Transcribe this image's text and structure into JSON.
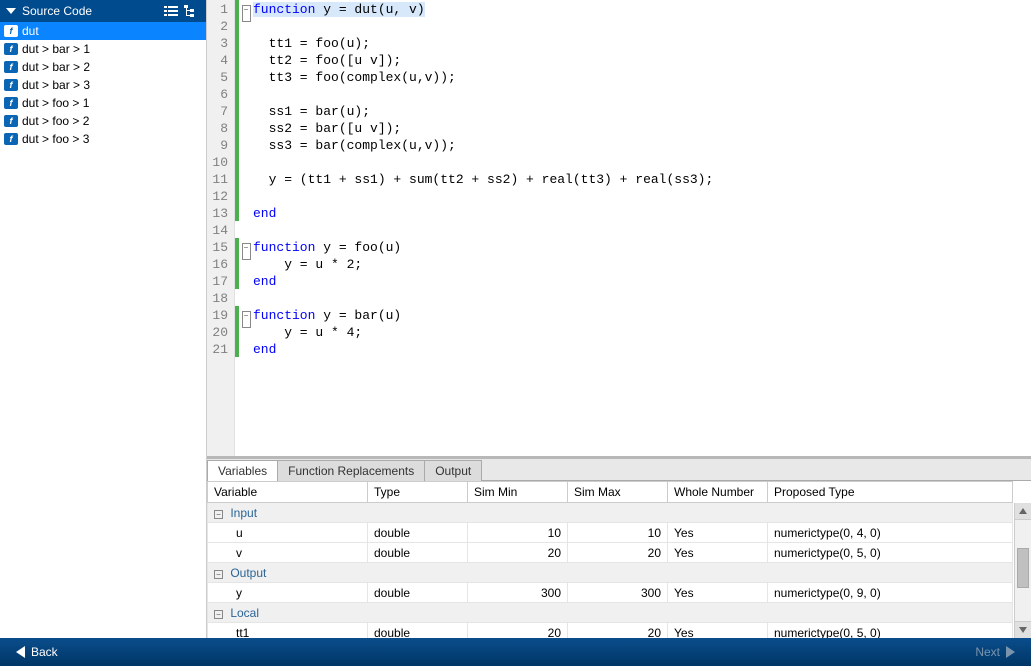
{
  "sidebar": {
    "title": "Source Code",
    "items": [
      {
        "label": "dut",
        "selected": true
      },
      {
        "label": "dut > bar > 1"
      },
      {
        "label": "dut > bar > 2"
      },
      {
        "label": "dut > bar > 3"
      },
      {
        "label": "dut > foo > 1"
      },
      {
        "label": "dut > foo > 2"
      },
      {
        "label": "dut > foo > 3"
      }
    ]
  },
  "editor": {
    "lines": [
      {
        "n": 1,
        "fold": "-",
        "hl": true,
        "tokens": [
          {
            "t": "function ",
            "k": true
          },
          {
            "t": "y = dut(u, v)"
          }
        ]
      },
      {
        "n": 2,
        "tokens": []
      },
      {
        "n": 3,
        "tokens": [
          {
            "t": "  tt1 = foo(u);"
          }
        ]
      },
      {
        "n": 4,
        "tokens": [
          {
            "t": "  tt2 = foo([u v]);"
          }
        ]
      },
      {
        "n": 5,
        "tokens": [
          {
            "t": "  tt3 = foo(complex(u,v));"
          }
        ]
      },
      {
        "n": 6,
        "tokens": []
      },
      {
        "n": 7,
        "tokens": [
          {
            "t": "  ss1 = bar(u);"
          }
        ]
      },
      {
        "n": 8,
        "tokens": [
          {
            "t": "  ss2 = bar([u v]);"
          }
        ]
      },
      {
        "n": 9,
        "tokens": [
          {
            "t": "  ss3 = bar(complex(u,v));"
          }
        ]
      },
      {
        "n": 10,
        "tokens": []
      },
      {
        "n": 11,
        "tokens": [
          {
            "t": "  y = (tt1 + ss1) + sum(tt2 + ss2) + real(tt3) + real(ss3);"
          }
        ]
      },
      {
        "n": 12,
        "tokens": []
      },
      {
        "n": 13,
        "tokens": [
          {
            "t": "end",
            "k": true
          }
        ]
      },
      {
        "n": 14,
        "nobar": true,
        "tokens": []
      },
      {
        "n": 15,
        "fold": "-",
        "tokens": [
          {
            "t": "function ",
            "k": true
          },
          {
            "t": "y = foo(u)"
          }
        ]
      },
      {
        "n": 16,
        "tokens": [
          {
            "t": "    y = u * 2;"
          }
        ]
      },
      {
        "n": 17,
        "tokens": [
          {
            "t": "end",
            "k": true
          }
        ]
      },
      {
        "n": 18,
        "nobar": true,
        "tokens": []
      },
      {
        "n": 19,
        "fold": "-",
        "tokens": [
          {
            "t": "function ",
            "k": true
          },
          {
            "t": "y = bar(u)"
          }
        ]
      },
      {
        "n": 20,
        "tokens": [
          {
            "t": "    y = u * 4;"
          }
        ]
      },
      {
        "n": 21,
        "tokens": [
          {
            "t": "end",
            "k": true
          }
        ]
      }
    ]
  },
  "bottom": {
    "tabs": [
      {
        "label": "Variables",
        "active": true
      },
      {
        "label": "Function Replacements"
      },
      {
        "label": "Output"
      }
    ],
    "columns": [
      "Variable",
      "Type",
      "Sim Min",
      "Sim Max",
      "Whole Number",
      "Proposed Type"
    ],
    "groups": [
      {
        "name": "Input",
        "rows": [
          {
            "var": "u",
            "type": "double",
            "min": "10",
            "max": "10",
            "whole": "Yes",
            "prop": "numerictype(0, 4, 0)"
          },
          {
            "var": "v",
            "type": "double",
            "min": "20",
            "max": "20",
            "whole": "Yes",
            "prop": "numerictype(0, 5, 0)"
          }
        ]
      },
      {
        "name": "Output",
        "rows": [
          {
            "var": "y",
            "type": "double",
            "min": "300",
            "max": "300",
            "whole": "Yes",
            "prop": "numerictype(0, 9, 0)"
          }
        ]
      },
      {
        "name": "Local",
        "rows": [
          {
            "var": "tt1",
            "type": "double",
            "min": "20",
            "max": "20",
            "whole": "Yes",
            "prop": "numerictype(0, 5, 0)"
          }
        ]
      }
    ]
  },
  "footer": {
    "back": "Back",
    "next": "Next"
  }
}
